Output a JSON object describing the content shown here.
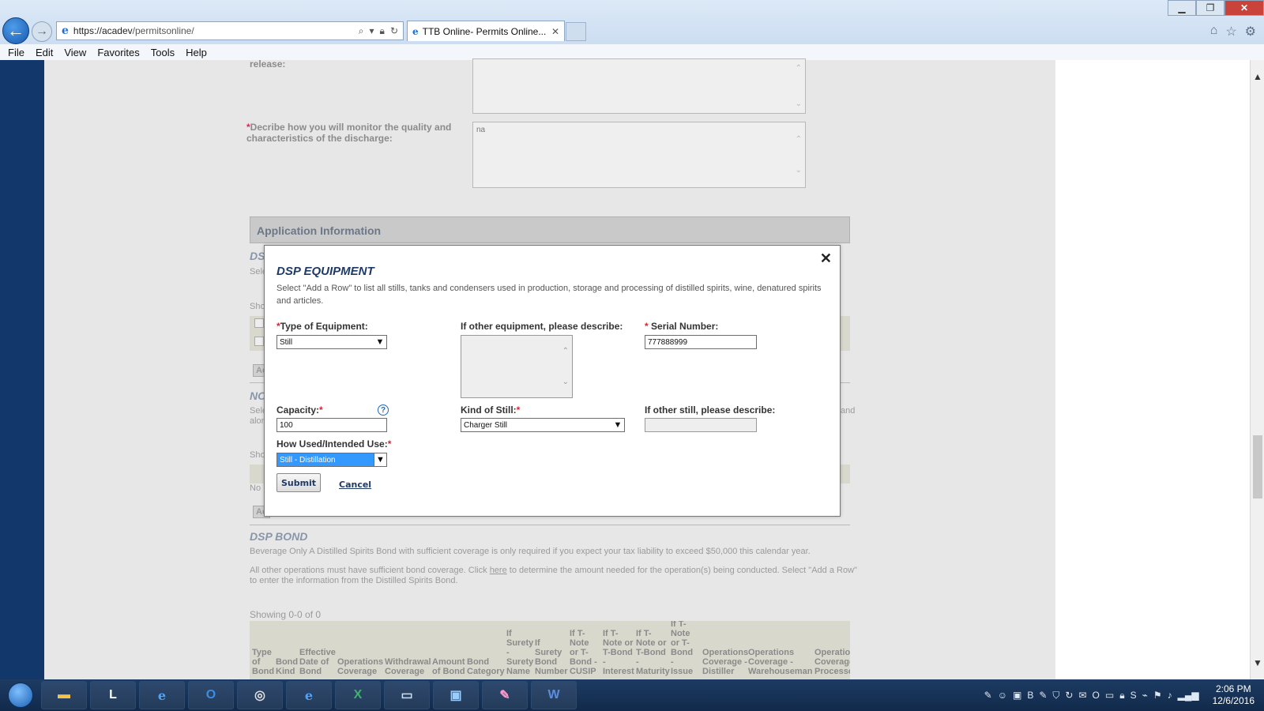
{
  "browser": {
    "url_host": "https://acadev",
    "url_path": "/permitsonline/",
    "tab_title": "TTB Online- Permits Online...",
    "menu": [
      "File",
      "Edit",
      "View",
      "Favorites",
      "Tools",
      "Help"
    ]
  },
  "background": {
    "release_label": "release:",
    "monitor_label": "Decribe how you will monitor the quality and characteristics of the discharge:",
    "monitor_value": "na",
    "section_title": "Application Information",
    "dsp_heading_stub": "DS",
    "nc_heading_stub": "NO",
    "select_stub": "Sele",
    "show_stub": "Sho",
    "add_stub": "Ac",
    "no_stub": "No",
    "and_stub": "and",
    "along_stub": "alon",
    "bond_heading": "DSP BOND",
    "bond_text1": "Beverage Only  A Distilled Spirits Bond with sufficient coverage is only required if you expect your tax liability to exceed $50,000 this calendar year.",
    "bond_text2_a": "All other operations must have sufficient bond coverage. Click ",
    "bond_text2_link": "here",
    "bond_text2_b": " to determine the amount needed for the operation(s) being conducted. Select \"Add a Row\" to enter the information from the Distilled Spirits Bond.",
    "showing": "Showing 0-0 of 0",
    "bond_columns": [
      "Type of Bond",
      "Bond Kind",
      "Effective Date of Bond",
      "Operations Coverage",
      "Withdrawal Coverage",
      "Amount of Bond",
      "Bond Category",
      "If Surety - Surety Name",
      "If Surety Bond Number",
      "If T-Note or T-Bond - CUSIP",
      "If T-Note or T-Bond - Interest",
      "If T-Note or T-Bond - Maturity",
      "If T-Note or T-Bond - Issue",
      "Operations Coverage - Distiller",
      "Operations Coverage - Warehouseman",
      "Operations Coverage - Processor"
    ]
  },
  "modal": {
    "title": "DSP EQUIPMENT",
    "description": "Select \"Add a Row\" to list all stills, tanks and condensers used in production, storage and processing of distilled spirits, wine, denatured spirits and articles.",
    "type_label": "Type of Equipment:",
    "type_value": "Still",
    "other_equipment_label": "If other equipment, please describe:",
    "serial_label": "Serial Number:",
    "serial_value": "777888999",
    "capacity_label": "Capacity:",
    "capacity_value": "100",
    "kind_label": "Kind of Still:",
    "kind_value": "Charger Still",
    "other_still_label": "If other still, please describe:",
    "use_label": "How Used/Intended Use:",
    "use_value": "Still - Distillation",
    "submit_label": "Submit",
    "cancel_label": "Cancel",
    "close_glyph": "✕",
    "help_glyph": "?"
  },
  "taskbar": {
    "time": "2:06 PM",
    "date": "12/6/2016"
  }
}
